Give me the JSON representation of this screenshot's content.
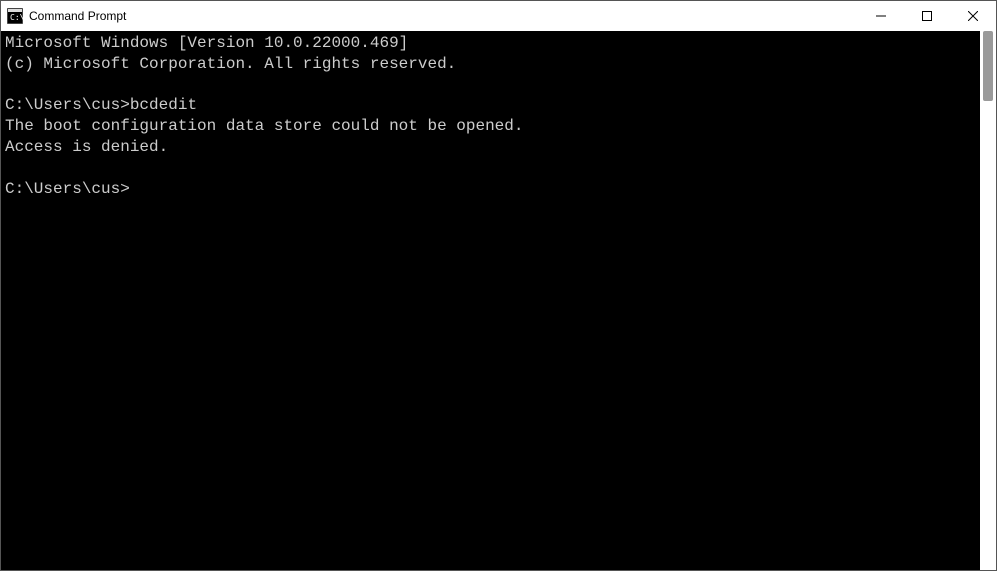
{
  "window": {
    "title": "Command Prompt"
  },
  "terminal": {
    "lines": {
      "l0": "Microsoft Windows [Version 10.0.22000.469]",
      "l1": "(c) Microsoft Corporation. All rights reserved.",
      "l2": "",
      "l3_prompt": "C:\\Users\\cus>",
      "l3_cmd": "bcdedit",
      "l4": "The boot configuration data store could not be opened.",
      "l5": "Access is denied.",
      "l6": "",
      "l7_prompt": "C:\\Users\\cus>"
    }
  }
}
